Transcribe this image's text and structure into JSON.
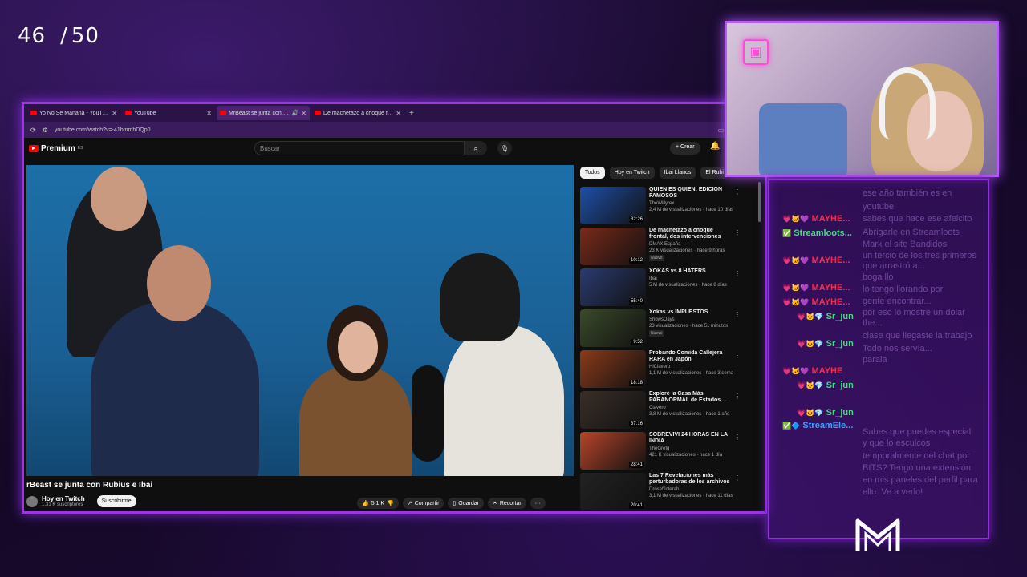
{
  "counter": {
    "current": "46",
    "sep": "/",
    "total": "50"
  },
  "browser": {
    "tabs": [
      {
        "label": "Yo No Sé Mañana - YouTube"
      },
      {
        "label": "YouTube"
      },
      {
        "label": "MrBeast se junta con Rubius"
      },
      {
        "label": "De machetazo a choque frontal"
      }
    ],
    "url": "youtube.com/watch?v=-41bmmbDQp0"
  },
  "yt": {
    "logo": "Premium",
    "logo_sup": "ES",
    "search_placeholder": "Buscar",
    "create_label": "Crear",
    "video_title": "rBeast se junta con Rubius e Ibai",
    "channel": "Hoy en Twitch",
    "subs": "1,31 K suscriptores",
    "subscribe": "Suscribirme",
    "likes": "5,1 K",
    "share": "Compartir",
    "save": "Guardar",
    "clip": "Recortar",
    "chips": [
      "Todos",
      "Hoy en Twitch",
      "Ibai Llanos",
      "El Rubi"
    ],
    "recs": [
      {
        "title": "QUIÉN ES QUIÉN: EDICIÓN FAMOSOS",
        "channel": "TheWillyrex",
        "meta": "2,4 M de visualizaciones · hace 10 días",
        "dur": "32:26",
        "color": "#1e4fa8",
        "new": ""
      },
      {
        "title": "De machetazo a choque frontal, dos intervenciones críticas en ...",
        "channel": "DMAX España",
        "meta": "23 K visualizaciones · hace 9 horas",
        "dur": "10:12",
        "color": "#7a2a1a",
        "new": "Nuevo"
      },
      {
        "title": "XOKAS vs 8 HATERS",
        "channel": "Ibai",
        "meta": "5 M de visualizaciones · hace 8 días",
        "dur": "55:40",
        "color": "#2a3b70",
        "new": ""
      },
      {
        "title": "Xokas vs IMPUESTOS",
        "channel": "ShowsDays",
        "meta": "23 visualizaciones · hace 51 minutos",
        "dur": "9:52",
        "color": "#3a4a2a",
        "new": "Nuevo"
      },
      {
        "title": "Probando Comida Callejera RARA en Japón",
        "channel": "HiClavero",
        "meta": "1,1 M de visualizaciones · hace 3 seman...",
        "dur": "18:18",
        "color": "#8a3a1a",
        "new": ""
      },
      {
        "title": "Exploré la Casa Más PARANORMAL de Estados ...",
        "channel": "Clavero",
        "meta": "3,8 M de visualizaciones · hace 1 año",
        "dur": "37:16",
        "color": "#3a2e28",
        "new": ""
      },
      {
        "title": "SOBREVIVÍ 24 HORAS EN LA INDIA",
        "channel": "TheGrefg",
        "meta": "421 K visualizaciones · hace 1 día",
        "dur": "28:41",
        "color": "#b8442a",
        "new": ""
      },
      {
        "title": "Las 7 Revelaciones más perturbadoras de los archivos ...",
        "channel": "Drosefficterah",
        "meta": "3,1 M de visualizaciones · hace 11 días",
        "dur": "20:41",
        "color": "#222222",
        "new": ""
      }
    ]
  },
  "chat": {
    "ghost": [
      "ese año también es en",
      "youtube",
      "sabes que hace ese afelcito",
      "Abrigarle en Streamloots",
      "Mark el site Bandidos",
      "un tercio de los tres primeros",
      "que arrastró a...",
      "boga llo",
      "lo tengo llorando por",
      "gente encontrar...",
      "por eso lo mostré un dólar",
      "the...",
      "clase que llegaste la trabajo",
      "Todo nos servía...",
      "parala",
      "Sabes que puedes especial",
      "y que lo esculcos",
      "temporalmente del chat por",
      "BITS? Tengo una extensión",
      "en mis paneles del perfil para",
      "ello. Ve a verlo!"
    ],
    "users": [
      {
        "name": "MAYHE...",
        "badges": "💗🐱💜",
        "cls": "u1"
      },
      {
        "name": "Streamloots...",
        "badges": "✅",
        "cls": "u2"
      },
      {
        "name": "MAYHE...",
        "badges": "💗🐱💜",
        "cls": "u1"
      },
      {
        "name": "MAYHE...",
        "badges": "💗🐱💜",
        "cls": "u1"
      },
      {
        "name": "MAYHE...",
        "badges": "💗🐱💜",
        "cls": "u1"
      },
      {
        "name": "Sr_jun",
        "badges": "💗🐱💎",
        "cls": "u2"
      },
      {
        "name": "Sr_jun",
        "badges": "💗🐱💎",
        "cls": "u2"
      },
      {
        "name": "MAYHE",
        "badges": "💗🐱💜",
        "cls": "u1"
      },
      {
        "name": "Sr_jun",
        "badges": "💗🐱💎",
        "cls": "u2"
      },
      {
        "name": "Sr_jun",
        "badges": "💗🐱💎",
        "cls": "u2"
      },
      {
        "name": "StreamEle...",
        "badges": "✅🔷",
        "cls": "u3"
      }
    ]
  }
}
